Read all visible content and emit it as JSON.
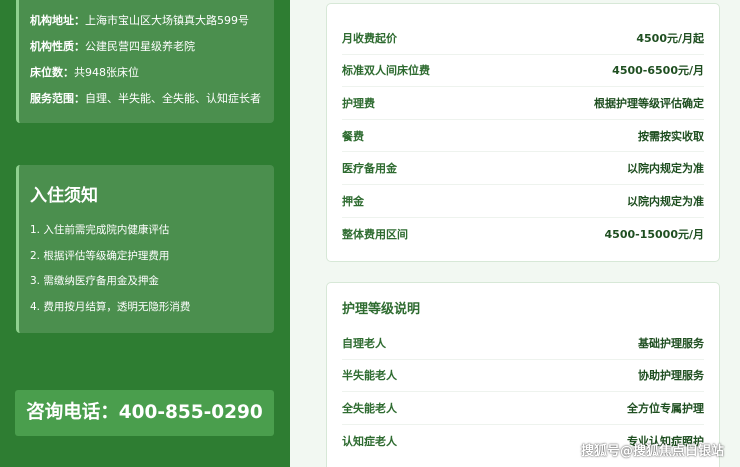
{
  "info": {
    "rows": [
      {
        "label": "机构地址：",
        "value": "上海市宝山区大场镇真大路599号"
      },
      {
        "label": "机构性质：",
        "value": "公建民营四星级养老院"
      },
      {
        "label": "床位数：",
        "value": "共948张床位"
      },
      {
        "label": "服务范围：",
        "value": "自理、半失能、全失能、认知症长者"
      }
    ]
  },
  "notice": {
    "title": "入住须知",
    "items": [
      "1. 入住前需完成院内健康评估",
      "2. 根据评估等级确定护理费用",
      "3. 需缴纳医疗备用金及押金",
      "4. 费用按月结算，透明无隐形消费"
    ]
  },
  "phone": {
    "text": "咨询电话：400-855-0290"
  },
  "fees": {
    "rows": [
      {
        "label": "月收费起价",
        "value": "4500元/月起"
      },
      {
        "label": "标准双人间床位费",
        "value": "4500-6500元/月"
      },
      {
        "label": "护理费",
        "value": "根据护理等级评估确定"
      },
      {
        "label": "餐费",
        "value": "按需按实收取"
      },
      {
        "label": "医疗备用金",
        "value": "以院内规定为准"
      },
      {
        "label": "押金",
        "value": "以院内规定为准"
      },
      {
        "label": "整体费用区间",
        "value": "4500-15000元/月"
      }
    ]
  },
  "levels": {
    "title": "护理等级说明",
    "rows": [
      {
        "label": "自理老人",
        "value": "基础护理服务"
      },
      {
        "label": "半失能老人",
        "value": "协助护理服务"
      },
      {
        "label": "全失能老人",
        "value": "全方位专属护理"
      },
      {
        "label": "认知症老人",
        "value": "专业认知症照护"
      }
    ]
  },
  "watermark": "搜狐号@搜狐焦点日银站",
  "colors": {
    "left_bg": "#2e7d32",
    "accent_text": "#2e6b30",
    "phone_bg": "#4a9e4d"
  }
}
